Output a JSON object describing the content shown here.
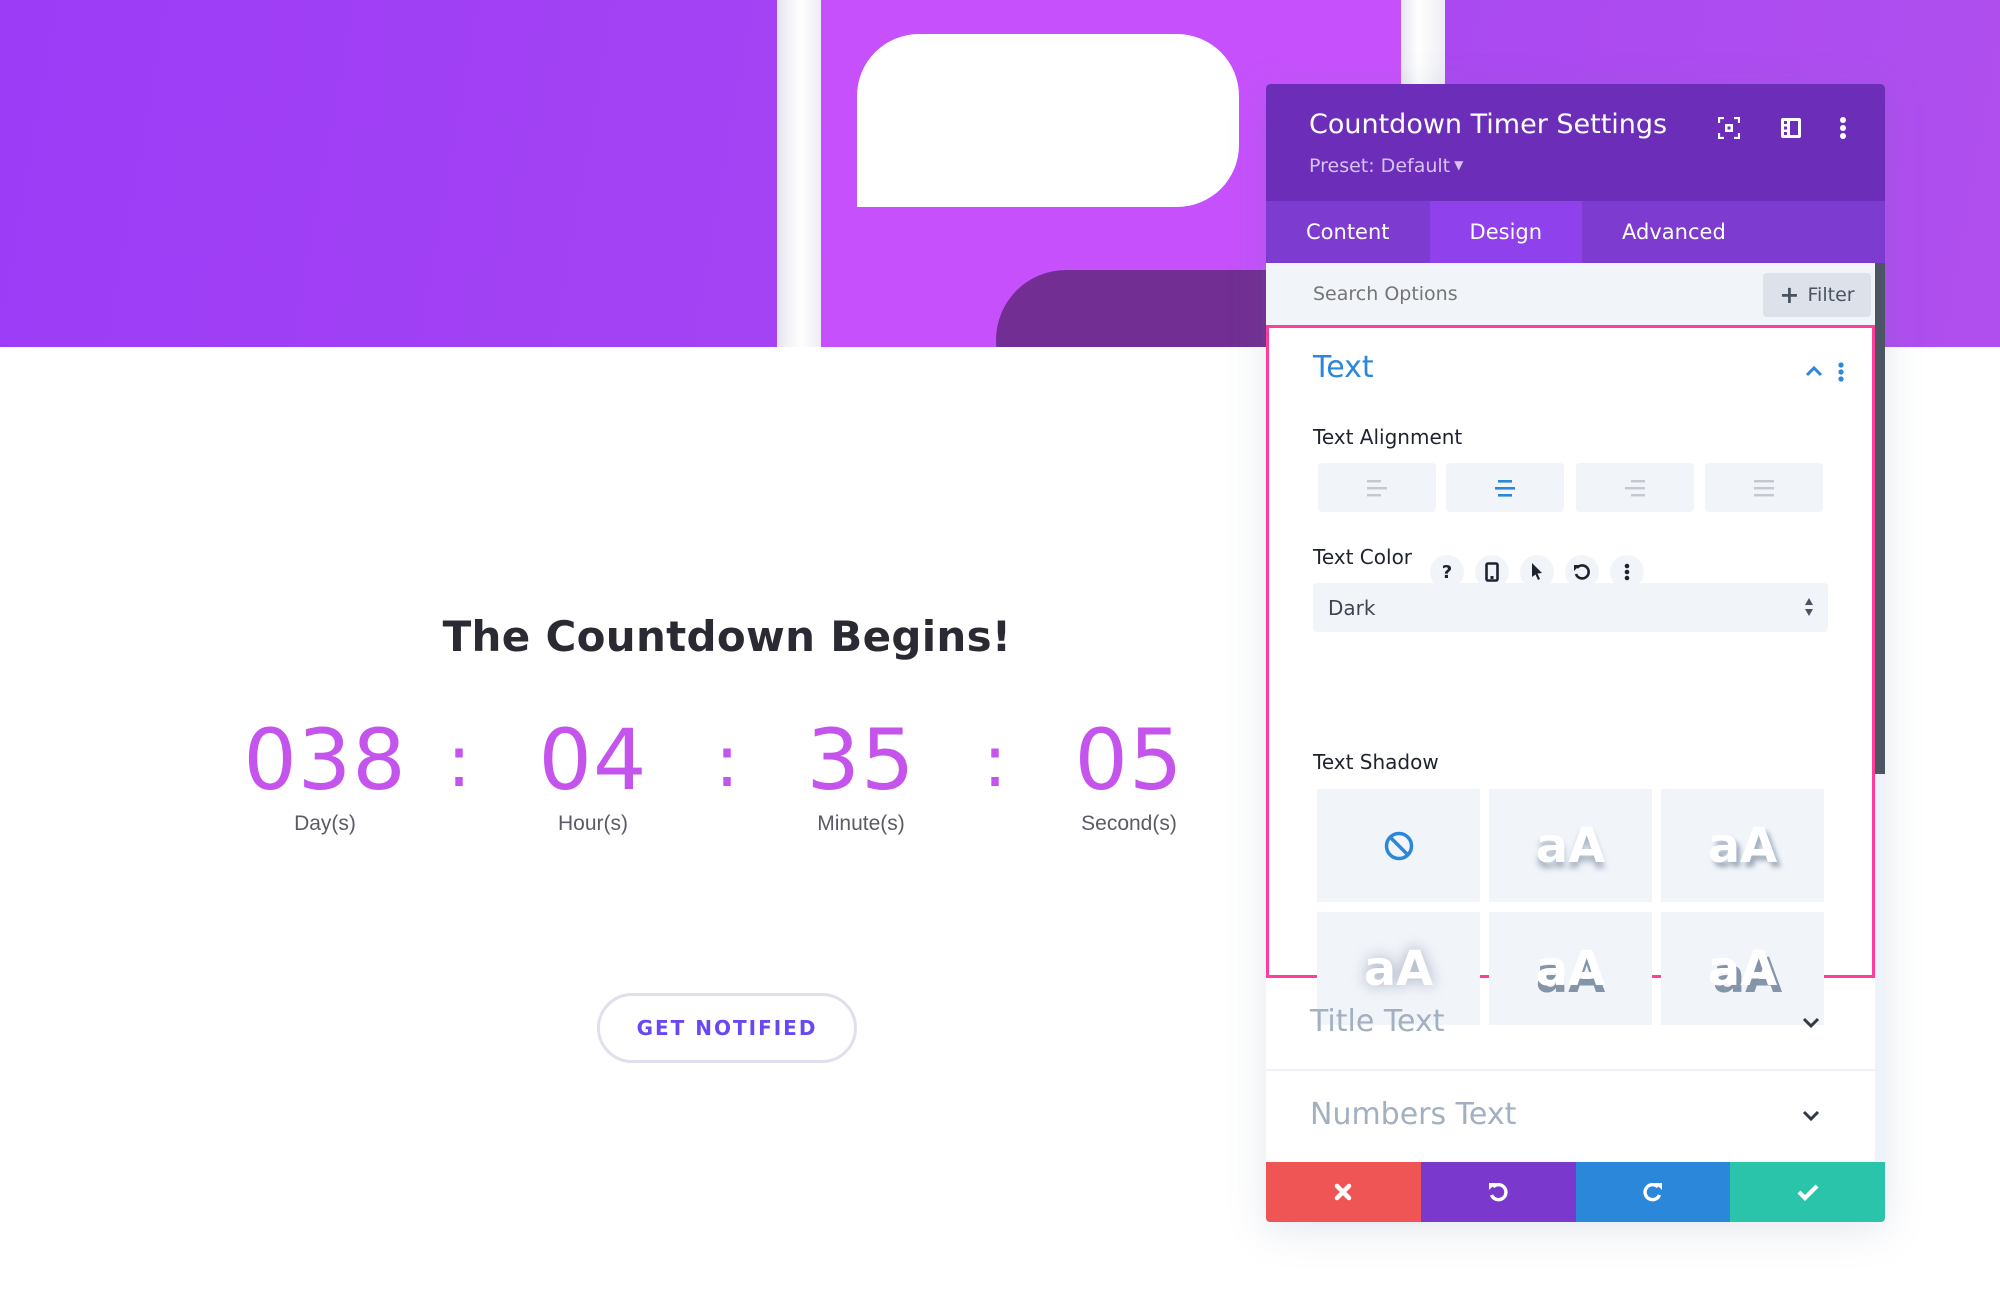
{
  "page": {
    "heading": "The Countdown Begins!",
    "countdown": [
      {
        "value": "038",
        "label": "Day(s)"
      },
      {
        "value": "04",
        "label": "Hour(s)"
      },
      {
        "value": "35",
        "label": "Minute(s)"
      },
      {
        "value": "05",
        "label": "Second(s)"
      }
    ],
    "separator": ":",
    "cta_label": "GET NOTIFIED"
  },
  "panel": {
    "title": "Countdown Timer Settings",
    "preset_label": "Preset: Default",
    "header_icons": [
      "expand-modal-icon",
      "sidebar-layout-icon",
      "more-options-icon"
    ],
    "tabs": [
      {
        "label": "Content",
        "active": false
      },
      {
        "label": "Design",
        "active": true
      },
      {
        "label": "Advanced",
        "active": false
      }
    ],
    "search": {
      "placeholder": "Search Options",
      "value": ""
    },
    "filter_label": "Filter",
    "sections": {
      "text": {
        "title": "Text",
        "expanded": true,
        "text_alignment": {
          "label": "Text Alignment",
          "options": [
            "left",
            "center",
            "right",
            "justify"
          ],
          "selected": "center"
        },
        "text_color": {
          "label": "Text Color",
          "icons": [
            "help-icon",
            "responsive-phone-icon",
            "hover-pointer-icon",
            "reset-icon",
            "more-options-icon"
          ],
          "value": "Dark"
        },
        "text_shadow": {
          "label": "Text Shadow",
          "preview_text": "aA",
          "options": [
            "none",
            "preset-1",
            "preset-2",
            "preset-3",
            "preset-4",
            "preset-5"
          ],
          "selected": "none"
        }
      },
      "collapsed": [
        {
          "title": "Title Text"
        },
        {
          "title": "Numbers Text"
        }
      ]
    },
    "footer_actions": [
      {
        "name": "cancel",
        "icon": "close-icon",
        "color": "#ef5555"
      },
      {
        "name": "undo",
        "icon": "undo-icon",
        "color": "#7b38cc"
      },
      {
        "name": "redo",
        "icon": "redo-icon",
        "color": "#2b87da"
      },
      {
        "name": "save",
        "icon": "check-icon",
        "color": "#29c4a9"
      }
    ]
  },
  "colors": {
    "accent_blue": "#2b87da",
    "countdown_number": "#c454ec",
    "highlight_border": "#ff3d9a",
    "header_purple": "#6c2eb9",
    "cta_text": "#6a47f5"
  }
}
